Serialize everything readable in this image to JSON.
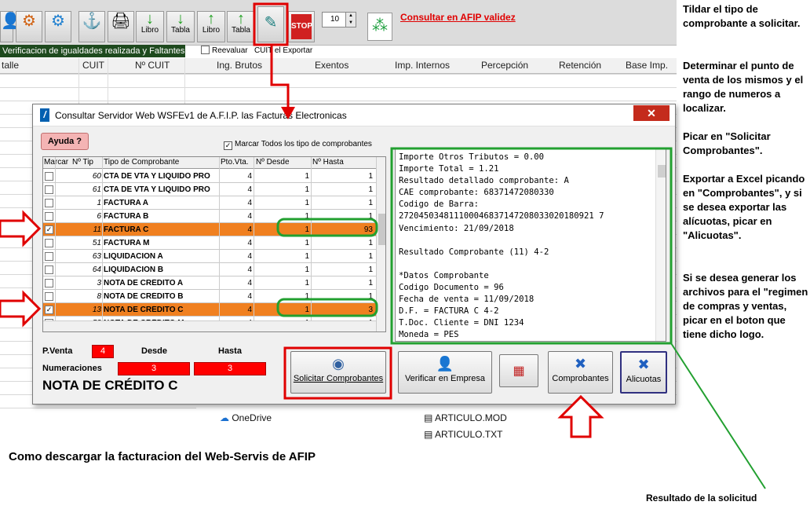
{
  "toolbar": {
    "buttons": [
      {
        "icon": "gear-icon",
        "label": ""
      },
      {
        "icon": "settings-icon",
        "label": ""
      },
      {
        "icon": "anchor-icon",
        "label": ""
      },
      {
        "icon": "printer-icon",
        "label": ""
      },
      {
        "icon": "arrow-down-icon",
        "label": "Libro"
      },
      {
        "icon": "arrow-down-icon",
        "label": "Tabla"
      },
      {
        "icon": "arrow-up-icon",
        "label": "Libro"
      },
      {
        "icon": "arrow-up-icon",
        "label": "Tabla"
      },
      {
        "icon": "afip-tilde-icon",
        "label": ""
      },
      {
        "icon": "stop-icon",
        "label": "STOP"
      }
    ],
    "spin_value": "10",
    "afip_link": "Consultar en AFIP validez"
  },
  "status_bar": {
    "message": "Verificacion de igualdades realizada y Faltantes",
    "reevaluar": "Reevaluar",
    "exportar": "CUIT el Exportar"
  },
  "grid": {
    "columns": [
      "talle",
      "CUIT",
      "Nº CUIT",
      "Ing. Brutos",
      "Exentos",
      "Imp. Internos",
      "Percepción",
      "Retención",
      "Base Imp."
    ]
  },
  "explorer": {
    "items": [
      "OneDrive",
      "ARTICULO.MOD",
      "ARTICULO.TXT"
    ]
  },
  "dialog": {
    "title": "Consultar  Servidor Web WSFEv1 de A.F.I.P. las Facturas Electronicas",
    "close": "✕",
    "help_button": "Ayuda ?",
    "mark_all": "Marcar Todos los tipo de comprobantes",
    "table": {
      "headers": [
        "Marcar",
        "Nº Tip",
        "Tipo de Comprobante",
        "Pto.Vta.",
        "Nº Desde",
        "Nº Hasta"
      ],
      "rows": [
        {
          "checked": false,
          "num": "60",
          "tipo": "CTA DE VTA Y LIQUIDO PRO",
          "pto": "4",
          "desde": "1",
          "hasta": "1",
          "selected": false
        },
        {
          "checked": false,
          "num": "61",
          "tipo": "CTA DE VTA Y LIQUIDO PRO",
          "pto": "4",
          "desde": "1",
          "hasta": "1",
          "selected": false
        },
        {
          "checked": false,
          "num": "1",
          "tipo": "FACTURA A",
          "pto": "4",
          "desde": "1",
          "hasta": "1",
          "selected": false
        },
        {
          "checked": false,
          "num": "6",
          "tipo": "FACTURA B",
          "pto": "4",
          "desde": "1",
          "hasta": "1",
          "selected": false
        },
        {
          "checked": true,
          "num": "11",
          "tipo": "FACTURA C",
          "pto": "4",
          "desde": "1",
          "hasta": "93",
          "selected": true
        },
        {
          "checked": false,
          "num": "51",
          "tipo": "FACTURA M",
          "pto": "4",
          "desde": "1",
          "hasta": "1",
          "selected": false
        },
        {
          "checked": false,
          "num": "63",
          "tipo": "LIQUIDACION A",
          "pto": "4",
          "desde": "1",
          "hasta": "1",
          "selected": false
        },
        {
          "checked": false,
          "num": "64",
          "tipo": "LIQUIDACION B",
          "pto": "4",
          "desde": "1",
          "hasta": "1",
          "selected": false
        },
        {
          "checked": false,
          "num": "3",
          "tipo": "NOTA DE CRÉDITO A",
          "pto": "4",
          "desde": "1",
          "hasta": "1",
          "selected": false
        },
        {
          "checked": false,
          "num": "8",
          "tipo": "NOTA DE CRÉDITO B",
          "pto": "4",
          "desde": "1",
          "hasta": "1",
          "selected": false
        },
        {
          "checked": true,
          "num": "13",
          "tipo": "NOTA DE CRÉDITO C",
          "pto": "4",
          "desde": "1",
          "hasta": "3",
          "selected": true
        },
        {
          "checked": false,
          "num": "53",
          "tipo": "NOTA DE CRÉDITO M",
          "pto": "4",
          "desde": "1",
          "hasta": "1",
          "selected": false
        }
      ]
    },
    "result_lines": [
      "Importe Otros Tributos = 0.00",
      "Importe Total = 1.21",
      "Resultado detallado comprobante: A",
      "CAE comprobante: 68371472080330",
      "Codigo de Barra:",
      "272045034811100046837147208033020180921 7",
      "Vencimiento: 21/09/2018",
      "",
      "Resultado Comprobante (11) 4-2",
      "",
      "*Datos Comprobante",
      "Codigo Documento = 96",
      "Fecha de venta = 11/09/2018",
      "D.F. = FACTURA C 4-2",
      "T.Doc. Cliente = DNI 1234",
      "Moneda = PES"
    ],
    "fields": {
      "pventa_label": "P.Venta",
      "pventa_value": "4",
      "desde_label": "Desde",
      "hasta_label": "Hasta",
      "numeraciones_label": "Numeraciones",
      "desde_value": "3",
      "hasta_value": "3"
    },
    "selected_type": "NOTA DE CRÉDITO C",
    "buttons": {
      "solicitar": "Solicitar Comprobantes",
      "verificar": "Verificar en Empresa",
      "regimen": "",
      "comprobantes": "Comprobantes",
      "alicuotas": "Alicuotas"
    }
  },
  "annotations": {
    "step1": "Tildar el tipo de comprobante a solicitar.",
    "step2": "Determinar el punto de venta de los mismos y el rango de numeros a localizar.",
    "step3": "Picar en \"Solicitar Comprobantes\".",
    "step4": "Exportar a Excel picando en \"Comprobantes\", y si se desea exportar las alícuotas, picar en \"Alicuotas\".",
    "step5": "Si se desea generar los archivos para el \"regimen de compras y ventas, picar en el boton que tiene dicho logo.",
    "caption": "Como descargar la facturacion del Web-Servis de AFIP",
    "result_caption": "Resultado de la solicitud"
  },
  "colors": {
    "selected_row": "#f08020",
    "highlight_red": "#e00000",
    "highlight_green": "#22a030"
  }
}
